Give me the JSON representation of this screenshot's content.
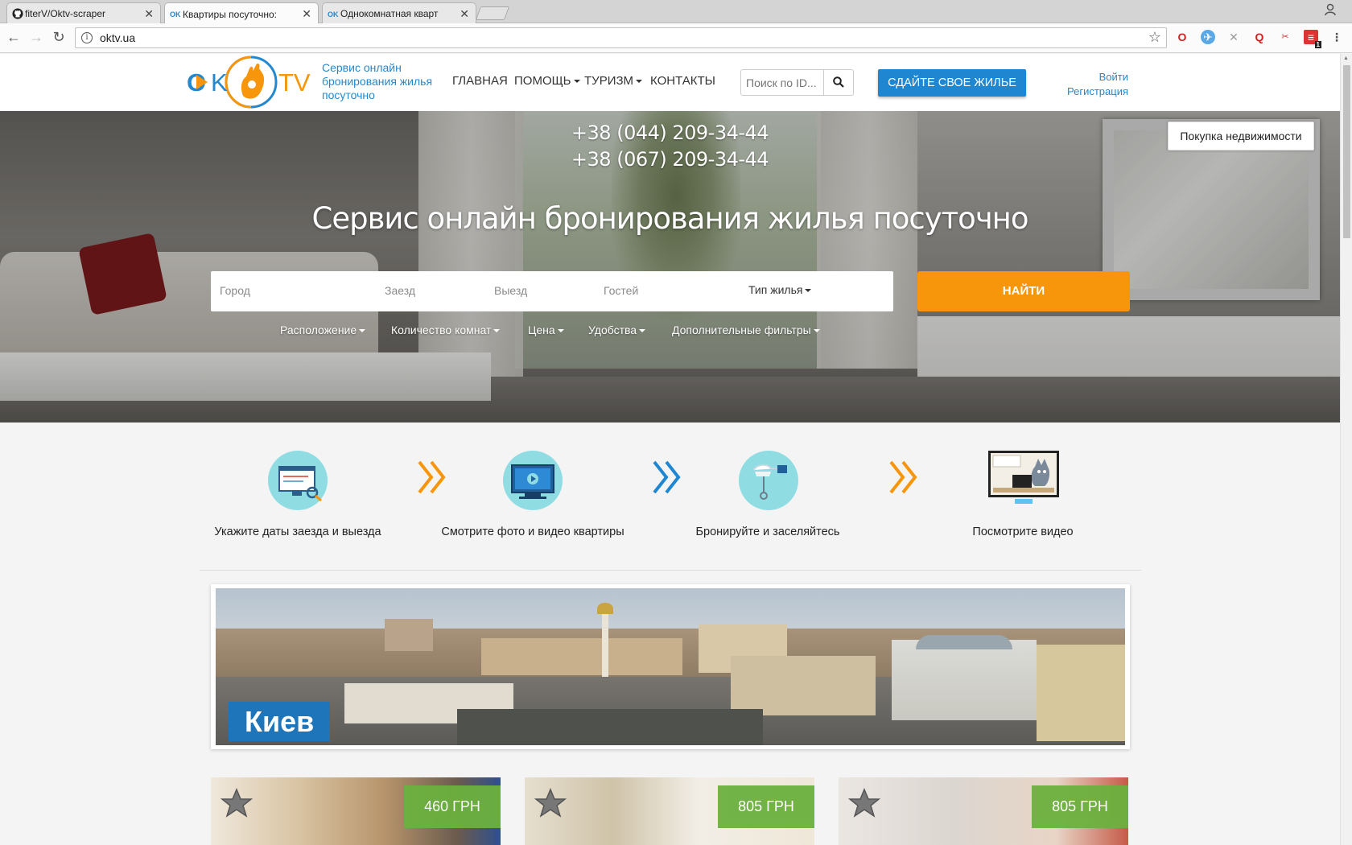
{
  "browser": {
    "tabs": [
      {
        "label": "fiterV/Oktv-scraper",
        "icon": "github-icon"
      },
      {
        "label": "Квартиры посуточно: ",
        "icon": "ok-favicon"
      },
      {
        "label": "Однокомнатная кварт",
        "icon": "ok-favicon"
      }
    ],
    "url": "oktv.ua",
    "ext_badge": "1"
  },
  "header": {
    "logo_ok": "OK",
    "logo_tv": "TV",
    "tagline": "Сервис онлайн бронирования жилья посуточно",
    "menu": [
      "ГЛАВНАЯ",
      "ПОМОЩЬ",
      "ТУРИЗМ",
      "КОНТАКТЫ"
    ],
    "search_placeholder": "Поиск по ID...",
    "rent_button": "СДАЙТЕ СВОЕ ЖИЛЬЕ",
    "login": "Войти",
    "register": "Регистрация"
  },
  "hero": {
    "phone1": "+38 (044) 209-34-44",
    "phone2": "+38 (067) 209-34-44",
    "title": "Сервис онлайн бронирования жилья посуточно",
    "buy_button": "Покупка недвижимости",
    "fields": {
      "city": "Город",
      "checkin": "Заезд",
      "checkout": "Выезд",
      "guests": "Гостей",
      "type": "Тип жилья"
    },
    "find_button": "НАЙТИ",
    "filters": [
      "Расположение",
      "Количество комнат",
      "Цена",
      "Удобства",
      "Дополнительные фильтры"
    ]
  },
  "steps": [
    {
      "label": "Укажите даты заезда и выезда",
      "icon": "calendar-search-icon"
    },
    {
      "label": "Смотрите фото и видео квартиры",
      "icon": "monitor-video-icon"
    },
    {
      "label": "Бронируйте и заселяйтесь",
      "icon": "key-hand-icon"
    },
    {
      "label": "Посмотрите видео",
      "icon": "video-thumbnail-icon"
    }
  ],
  "city_banner": {
    "label": "Киев"
  },
  "listings": [
    {
      "price": "460 ГРН"
    },
    {
      "price": "805 ГРН"
    },
    {
      "price": "805 ГРН"
    }
  ],
  "colors": {
    "brand_blue": "#1f87d2",
    "orange": "#f7950b",
    "price_green": "#6cb13f",
    "icon_teal": "#8fdde3"
  }
}
